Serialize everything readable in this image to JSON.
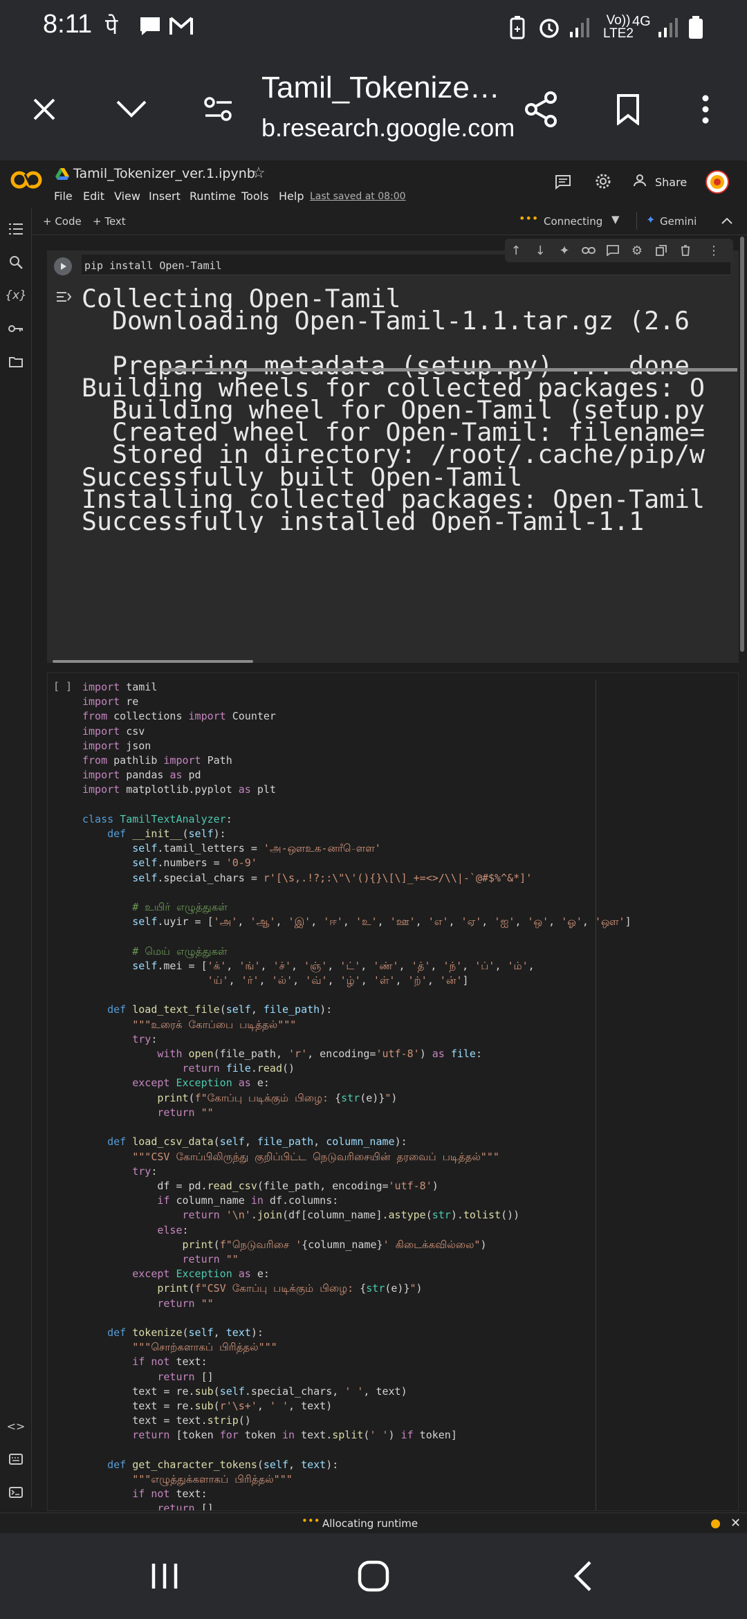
{
  "status_bar": {
    "time": "8:11",
    "glyph_pe": "पे",
    "network_label": "Vo)) LTE2",
    "network_type": "4G"
  },
  "browser": {
    "page_title": "Tamil_Tokenize…",
    "domain": "b.research.google.com"
  },
  "colab": {
    "notebook_name": "Tamil_Tokenizer_ver.1.ipynb",
    "menu": [
      "File",
      "Edit",
      "View",
      "Insert",
      "Runtime",
      "Tools",
      "Help"
    ],
    "last_saved": "Last saved at 08:00",
    "share_label": "Share",
    "add_code": "+ Code",
    "add_text": "+ Text",
    "connecting": "Connecting",
    "gemini": "Gemini",
    "runtime_status": "Allocating runtime",
    "accent": "#f9ab00"
  },
  "cell1": {
    "code": "pip install Open-Tamil",
    "output": "Collecting Open-Tamil\n  Downloading Open-Tamil-1.1.tar.gz (2.6\n\n  Preparing metadata (setup.py) ... done\nBuilding wheels for collected packages: O\n  Building wheel for Open-Tamil (setup.py\n  Created wheel for Open-Tamil: filename=\n  Stored in directory: /root/.cache/pip/w\nSuccessfully built Open-Tamil\nInstalling collected packages: Open-Tamil\nSuccessfully installed Open-Tamil-1.1"
  },
  "cell2": {
    "bracket": "[ ]"
  }
}
